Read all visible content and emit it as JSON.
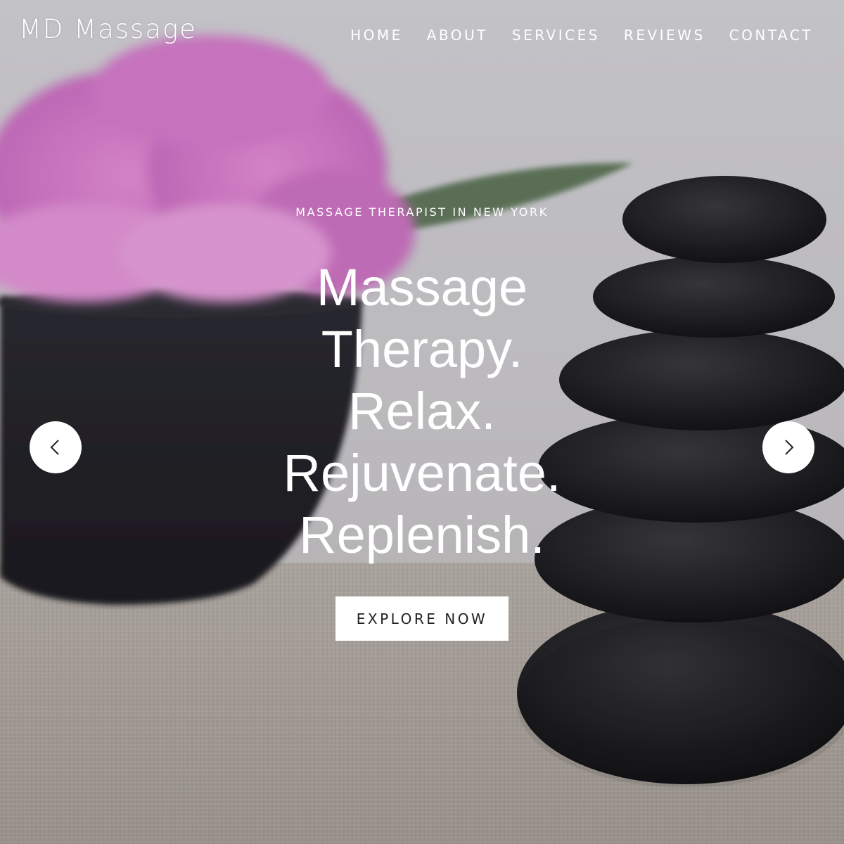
{
  "site": {
    "logo": "MD Massage"
  },
  "nav": {
    "items": [
      {
        "label": "HOME"
      },
      {
        "label": "ABOUT"
      },
      {
        "label": "SERVICES"
      },
      {
        "label": "REVIEWS"
      },
      {
        "label": "CONTACT"
      }
    ]
  },
  "hero": {
    "tagline": "MASSAGE THERAPIST IN NEW YORK",
    "headline_lines": [
      "Massage",
      "Therapy.",
      "Relax.",
      "Rejuvenate.",
      "Replenish."
    ],
    "cta_label": "EXPLORE NOW",
    "prev_icon": "chevron-left-icon",
    "next_icon": "chevron-right-icon"
  },
  "colors": {
    "text": "#ffffff",
    "button_bg": "#ffffff",
    "button_text": "#222222"
  }
}
